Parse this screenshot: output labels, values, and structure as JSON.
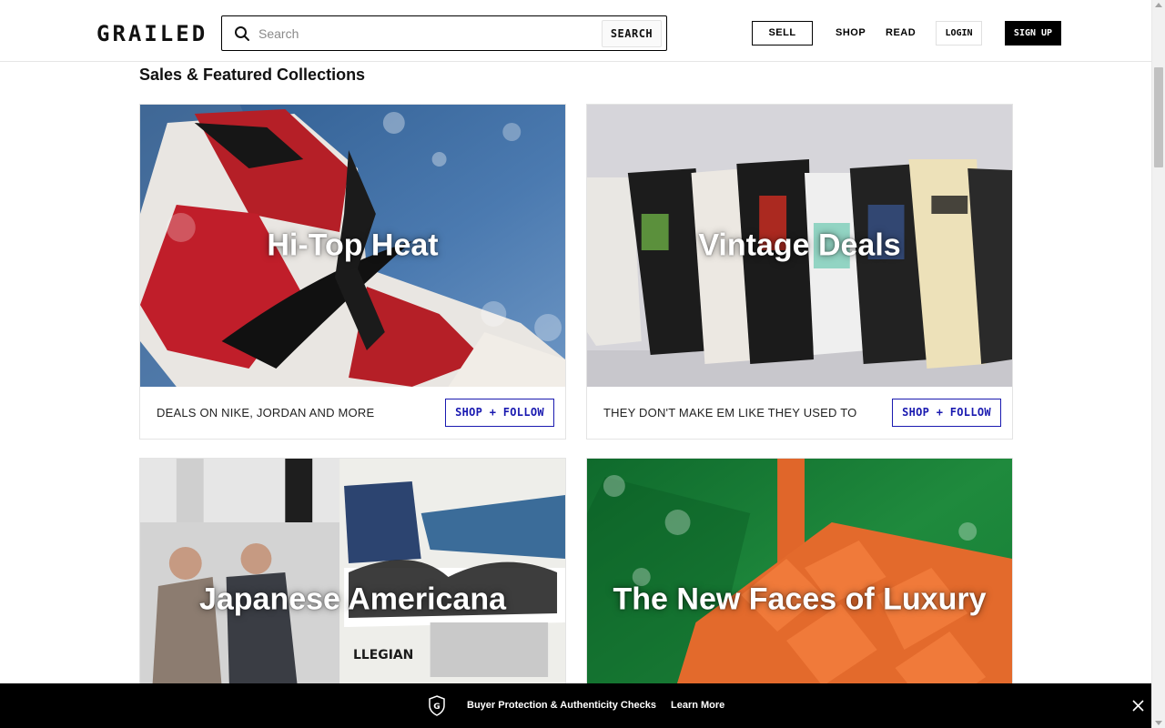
{
  "header": {
    "logo": "GRAILED",
    "search": {
      "placeholder": "Search",
      "button_label": "SEARCH"
    },
    "nav": {
      "sell": "SELL",
      "shop": "SHOP",
      "read": "READ",
      "login": "LOGIN",
      "signup": "SIGN UP"
    }
  },
  "main": {
    "section_title": "Sales & Featured Collections",
    "cards": [
      {
        "title": "Hi-Top Heat",
        "description": "DEALS ON NIKE, JORDAN AND MORE",
        "button": "SHOP + FOLLOW",
        "image": "red-sneaker-photo"
      },
      {
        "title": "Vintage Deals",
        "description": "THEY DON'T MAKE EM LIKE THEY USED TO",
        "button": "SHOP + FOLLOW",
        "image": "vintage-tees-photo"
      },
      {
        "title": "Japanese Americana",
        "description": "",
        "button": "",
        "image": "workwear-collage-photo"
      },
      {
        "title": "The New Faces of Luxury",
        "description": "",
        "button": "",
        "image": "orange-woven-bag-photo"
      }
    ]
  },
  "banner": {
    "icon": "shield-g-icon",
    "text": "Buyer Protection & Authenticity Checks",
    "link": "Learn More"
  },
  "colors": {
    "accent": "#1a1ab0",
    "banner_bg": "#000000"
  }
}
